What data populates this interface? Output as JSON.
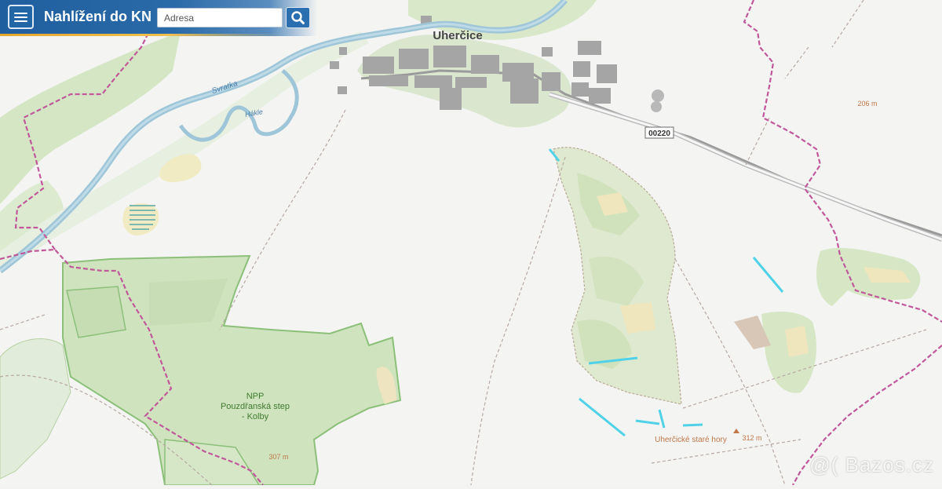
{
  "header": {
    "menu_icon": "hamburger-menu-icon",
    "title": "Nahlížení do KN",
    "search_placeholder": "Adresa",
    "search_icon": "magnifier-search-icon",
    "colors": {
      "bar": "#1f5f9f",
      "accent": "#e7a52c"
    }
  },
  "map": {
    "labels": {
      "village": "Uherčice",
      "river": "Svratka",
      "stream": "Hákle",
      "road_number": "00220",
      "spot_elev_ne": "206 m",
      "reserve_line1": "NPP",
      "reserve_line2": "Pouzdřanská step",
      "reserve_line3": "- Kolby",
      "spot_elev_sw": "307 m",
      "hill_name": "Uherčické staré hory",
      "hill_elev": "312 m"
    },
    "colors": {
      "forest": "#cfe3bf",
      "forest_border": "#8cc07a",
      "river": "#a6c9d8",
      "boundary": "#c0589a",
      "built_up": "#a9a9a9",
      "field": "#f2ecc2"
    }
  },
  "watermark": "@( Bazos.cz"
}
